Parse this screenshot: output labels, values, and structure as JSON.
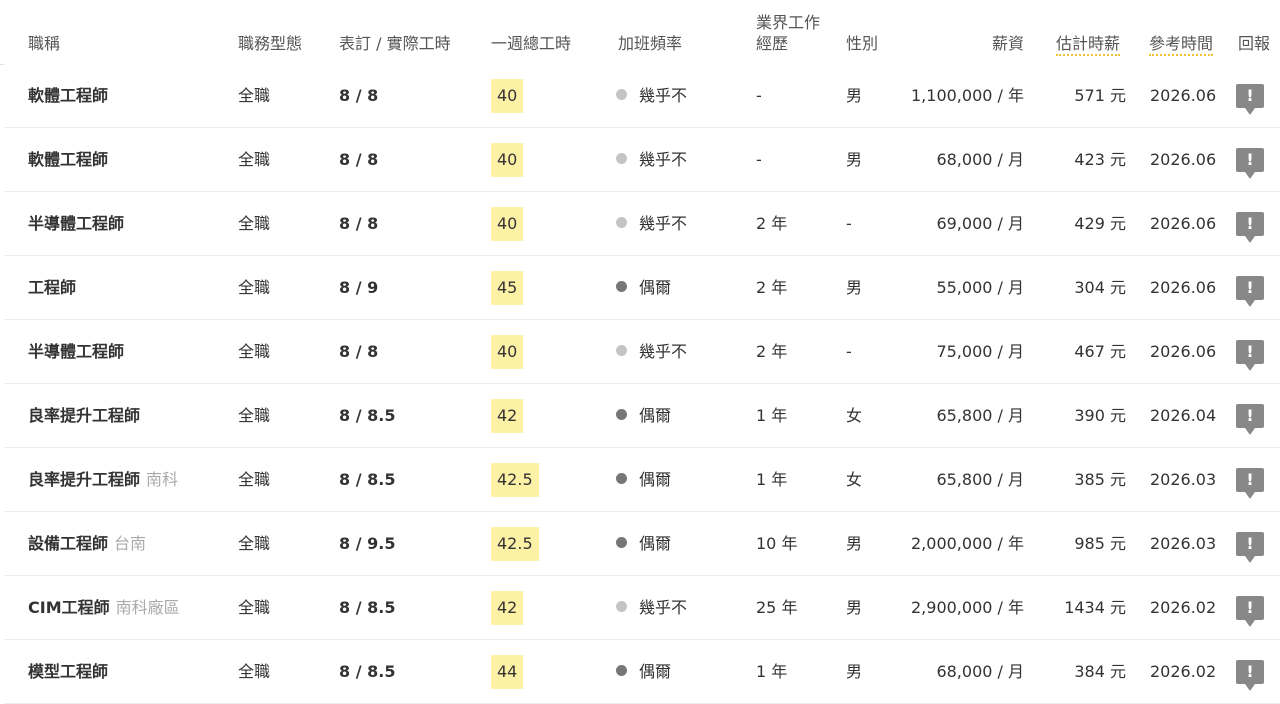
{
  "headers": {
    "title": "職稱",
    "type": "職務型態",
    "hours": "表訂 / 實際工時",
    "week": "一週總工時",
    "ot": "加班頻率",
    "exp_line1": "業界工作",
    "exp_line2": "經歷",
    "gender": "性別",
    "salary": "薪資",
    "hourly": "估計時薪",
    "date": "參考時間",
    "report": "回報"
  },
  "colors": {
    "dot_rarely": "#c4c4c4",
    "dot_sometimes": "#777777",
    "highlight": "#fdf1a6",
    "underline": "#f0c330"
  },
  "report_icon": "exclamation-speech-icon",
  "rows": [
    {
      "title": "軟體工程師",
      "location": "",
      "type": "全職",
      "hours": "8 / 8",
      "week": "40",
      "ot": "幾乎不",
      "ot_level": "rarely",
      "exp": "-",
      "gender": "男",
      "salary": "1,100,000 / 年",
      "hourly": "571 元",
      "date": "2026.06",
      "report": "!"
    },
    {
      "title": "軟體工程師",
      "location": "",
      "type": "全職",
      "hours": "8 / 8",
      "week": "40",
      "ot": "幾乎不",
      "ot_level": "rarely",
      "exp": "-",
      "gender": "男",
      "salary": "68,000 / 月",
      "hourly": "423 元",
      "date": "2026.06",
      "report": "!"
    },
    {
      "title": "半導體工程師",
      "location": "",
      "type": "全職",
      "hours": "8 / 8",
      "week": "40",
      "ot": "幾乎不",
      "ot_level": "rarely",
      "exp": "2 年",
      "gender": "-",
      "salary": "69,000 / 月",
      "hourly": "429 元",
      "date": "2026.06",
      "report": "!"
    },
    {
      "title": "工程師",
      "location": "",
      "type": "全職",
      "hours": "8 / 9",
      "week": "45",
      "ot": "偶爾",
      "ot_level": "sometimes",
      "exp": "2 年",
      "gender": "男",
      "salary": "55,000 / 月",
      "hourly": "304 元",
      "date": "2026.06",
      "report": "!"
    },
    {
      "title": "半導體工程師",
      "location": "",
      "type": "全職",
      "hours": "8 / 8",
      "week": "40",
      "ot": "幾乎不",
      "ot_level": "rarely",
      "exp": "2 年",
      "gender": "-",
      "salary": "75,000 / 月",
      "hourly": "467 元",
      "date": "2026.06",
      "report": "!"
    },
    {
      "title": "良率提升工程師",
      "location": "",
      "type": "全職",
      "hours": "8 / 8.5",
      "week": "42",
      "ot": "偶爾",
      "ot_level": "sometimes",
      "exp": "1 年",
      "gender": "女",
      "salary": "65,800 / 月",
      "hourly": "390 元",
      "date": "2026.04",
      "report": "!"
    },
    {
      "title": "良率提升工程師",
      "location": "南科",
      "type": "全職",
      "hours": "8 / 8.5",
      "week": "42.5",
      "ot": "偶爾",
      "ot_level": "sometimes",
      "exp": "1 年",
      "gender": "女",
      "salary": "65,800 / 月",
      "hourly": "385 元",
      "date": "2026.03",
      "report": "!"
    },
    {
      "title": "設備工程師",
      "location": "台南",
      "type": "全職",
      "hours": "8 / 9.5",
      "week": "42.5",
      "ot": "偶爾",
      "ot_level": "sometimes",
      "exp": "10 年",
      "gender": "男",
      "salary": "2,000,000 / 年",
      "hourly": "985 元",
      "date": "2026.03",
      "report": "!"
    },
    {
      "title": "CIM工程師",
      "location": "南科廠區",
      "type": "全職",
      "hours": "8 / 8.5",
      "week": "42",
      "ot": "幾乎不",
      "ot_level": "rarely",
      "exp": "25 年",
      "gender": "男",
      "salary": "2,900,000 / 年",
      "hourly": "1434 元",
      "date": "2026.02",
      "report": "!"
    },
    {
      "title": "模型工程師",
      "location": "",
      "type": "全職",
      "hours": "8 / 8.5",
      "week": "44",
      "ot": "偶爾",
      "ot_level": "sometimes",
      "exp": "1 年",
      "gender": "男",
      "salary": "68,000 / 月",
      "hourly": "384 元",
      "date": "2026.02",
      "report": "!"
    }
  ]
}
